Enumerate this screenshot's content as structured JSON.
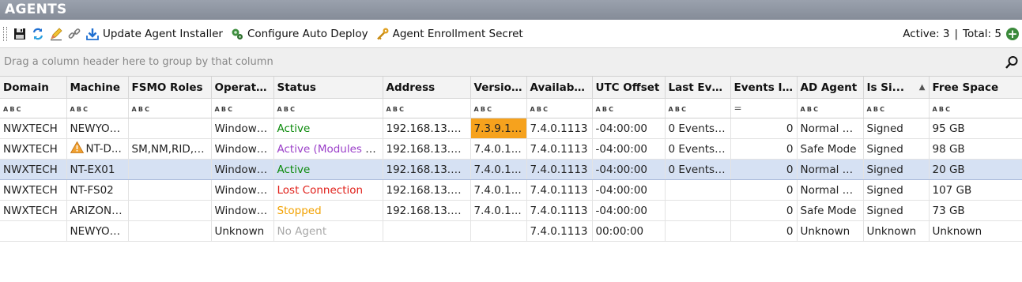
{
  "window": {
    "title": "AGENTS"
  },
  "toolbar": {
    "update_installer": "Update Agent Installer",
    "configure_auto_deploy": "Configure Auto Deploy",
    "enrollment_secret": "Agent Enrollment Secret",
    "active_label": "Active: 3",
    "separator": "|",
    "total_label": "Total: 5",
    "add_symbol": "+"
  },
  "groupbar": {
    "text": "Drag a column header here to group by that column"
  },
  "columns": [
    "Domain",
    "Machine",
    "FSMO Roles",
    "Operati...",
    "Status",
    "Address",
    "Versio...",
    "Availabl...",
    "UTC Offset",
    "Last Eve...",
    "Events I...",
    "AD Agent",
    "Is Si...",
    "Free Space"
  ],
  "filter_icons": {
    "abc": "A B C",
    "equals": "="
  },
  "rows": [
    [
      "NWXTECH",
      "NEWYOR...",
      "",
      "Windows ...",
      "Active",
      "192.168.13.96...",
      "7.3.9.120",
      "7.4.0.1113",
      "-04:00:00",
      "0 Events i...",
      "0",
      "Normal Mo...",
      "Signed",
      "95 GB"
    ],
    [
      "NWXTECH",
      "NT-D...",
      "SM,NM,RID,P...",
      "Windows ...",
      "Active (Modules Pe...",
      "192.168.13.10...",
      "7.4.0.1...",
      "7.4.0.1113",
      "-04:00:00",
      "0 Events i...",
      "0",
      "Safe Mode",
      "Signed",
      "98 GB"
    ],
    [
      "NWXTECH",
      "NT-EX01",
      "",
      "Windows ...",
      "Active",
      "192.168.13.54...",
      "7.4.0.1...",
      "7.4.0.1113",
      "-04:00:00",
      "0 Events i...",
      "0",
      "Normal Mo...",
      "Signed",
      "20 GB"
    ],
    [
      "NWXTECH",
      "NT-FS02",
      "",
      "Windows ...",
      "Lost Connection",
      "192.168.13.53...",
      "7.4.0.1...",
      "7.4.0.1113",
      "-04:00:00",
      "",
      "0",
      "Normal Mo...",
      "Signed",
      "107 GB"
    ],
    [
      "NWXTECH",
      "ARIZONA...",
      "",
      "Windows ...",
      "Stopped",
      "192.168.13.12...",
      "7.4.0.1...",
      "7.4.0.1113",
      "-04:00:00",
      "",
      "0",
      "Safe Mode",
      "Signed",
      "73 GB"
    ],
    [
      "",
      "NEWYOR...",
      "",
      "Unknown",
      "No Agent",
      "",
      "",
      "7.4.0.1113",
      "00:00:00",
      "",
      "0",
      "Unknown",
      "Unknown",
      "Unknown"
    ]
  ],
  "status_colors": {
    "Active": "#0a8a0a",
    "Active (Modules Pe...": "#9b3fc9",
    "Lost Connection": "#e0201a",
    "Stopped": "#f2a100",
    "No Agent": "#a8a8a8"
  },
  "highlight_color": "#f6a21d",
  "selected_row_color": "#d6e1f3",
  "icons": [
    "save-icon",
    "refresh-icon",
    "edit-icon",
    "link-icon",
    "download-icon",
    "gear-puzzle-icon",
    "key-icon",
    "plus-icon",
    "search-icon",
    "warning-icon",
    "sort-ascending-icon"
  ]
}
